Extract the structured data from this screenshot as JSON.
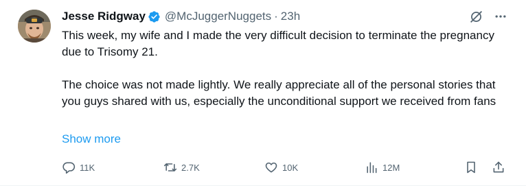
{
  "tweet": {
    "author_name": "Jesse Ridgway",
    "handle": "@McJuggerNuggets",
    "separator": "·",
    "timestamp": "23h",
    "paragraph1": "This week, my wife and I made the very difficult decision to terminate the pregnancy due to Trisomy 21.",
    "paragraph2": "The choice was not made lightly. We really appreciate all of the personal stories that you guys shared with us, especially the unconditional support we received from fans",
    "show_more": "Show more"
  },
  "actions": {
    "replies": "11K",
    "reposts": "2.7K",
    "likes": "10K",
    "views": "12M"
  },
  "icons": {
    "verified": "verified-badge-icon",
    "grok": "grok-icon",
    "more": "more-icon",
    "reply": "reply-icon",
    "repost": "repost-icon",
    "like": "heart-icon",
    "views": "views-icon",
    "bookmark": "bookmark-icon",
    "share": "share-icon"
  },
  "colors": {
    "text": "#0f1419",
    "secondary": "#536471",
    "link": "#1d9bf0",
    "verified": "#1d9bf0"
  }
}
